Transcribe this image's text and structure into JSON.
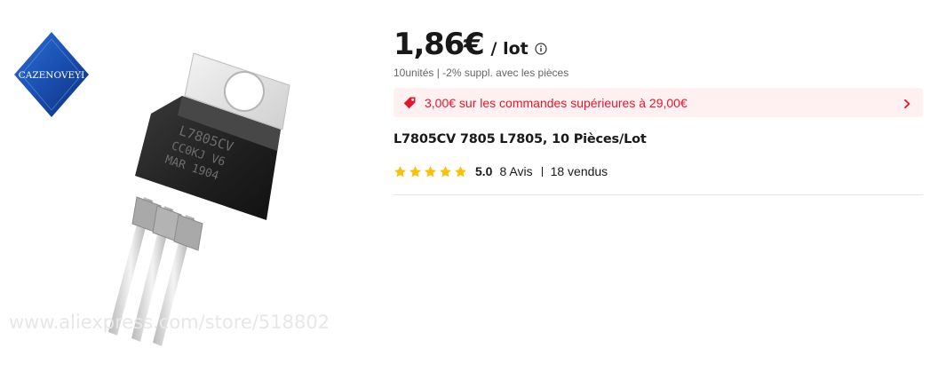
{
  "product_image": {
    "store_logo_text": "CAZENOVEYI",
    "chip_marking_line1": "L7805CV",
    "chip_marking_line2": "CC0KJ V6",
    "chip_marking_line3": "MAR  1904",
    "watermark_text": "www.aliexpress.com/store/518802"
  },
  "price": {
    "amount": "1,86€",
    "unit": "/ lot",
    "info_icon": "info-circle-icon"
  },
  "quantity_note": "10unités | -2% suppl. avec les pièces",
  "coupon": {
    "icon": "price-tag-icon",
    "text": "3,00€ sur les commandes supérieures à 29,00€",
    "chevron_icon": "chevron-right-icon",
    "colors": {
      "background": "#fff0f1",
      "text": "#e0192e"
    }
  },
  "product_title": "L7805CV 7805 L7805, 10 Pièces/Lot",
  "rating": {
    "stars_filled": 5,
    "stars_total": 5,
    "star_color": "#f9c10f",
    "value": "5.0",
    "reviews": "8 Avis",
    "sold": "18 vendus"
  }
}
